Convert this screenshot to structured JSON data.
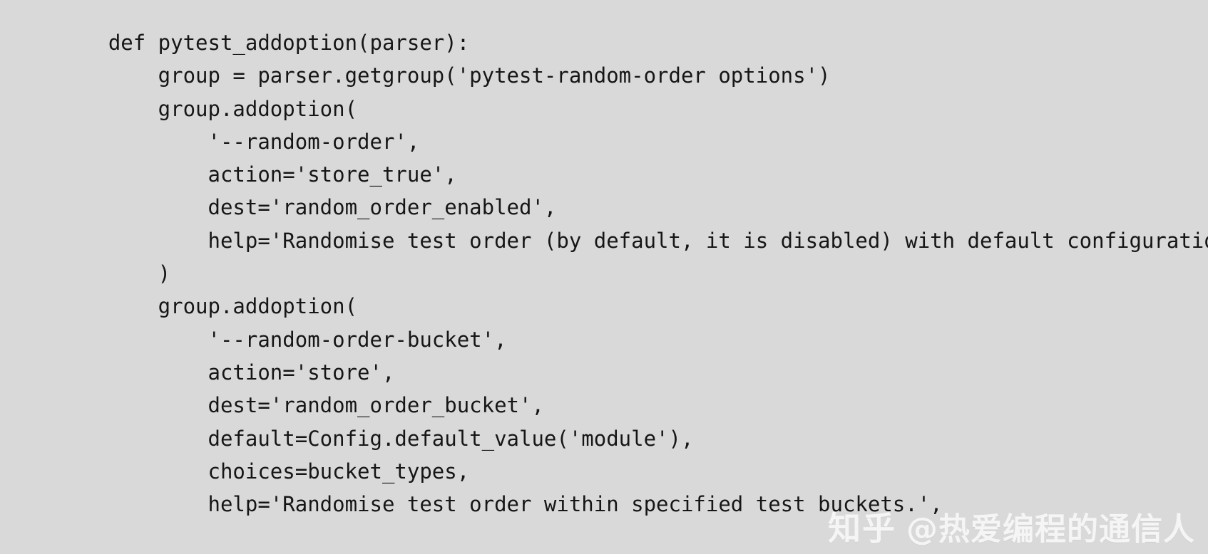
{
  "window": {
    "background_color": "#d9d9d9",
    "text_color": "#161616"
  },
  "code": {
    "language": "python",
    "lines": [
      "    def pytest_addoption(parser):",
      "        group = parser.getgroup('pytest-random-order options')",
      "        group.addoption(",
      "            '--random-order',",
      "            action='store_true',",
      "            dest='random_order_enabled',",
      "            help='Randomise test order (by default, it is disabled) with default configuration.',",
      "        )",
      "        group.addoption(",
      "            '--random-order-bucket',",
      "            action='store',",
      "            dest='random_order_bucket',",
      "            default=Config.default_value('module'),",
      "            choices=bucket_types,",
      "            help='Randomise test order within specified test buckets.',"
    ]
  },
  "watermark": {
    "logo": "知乎",
    "handle": "@热爱编程的通信人",
    "color": "#ffffff"
  }
}
